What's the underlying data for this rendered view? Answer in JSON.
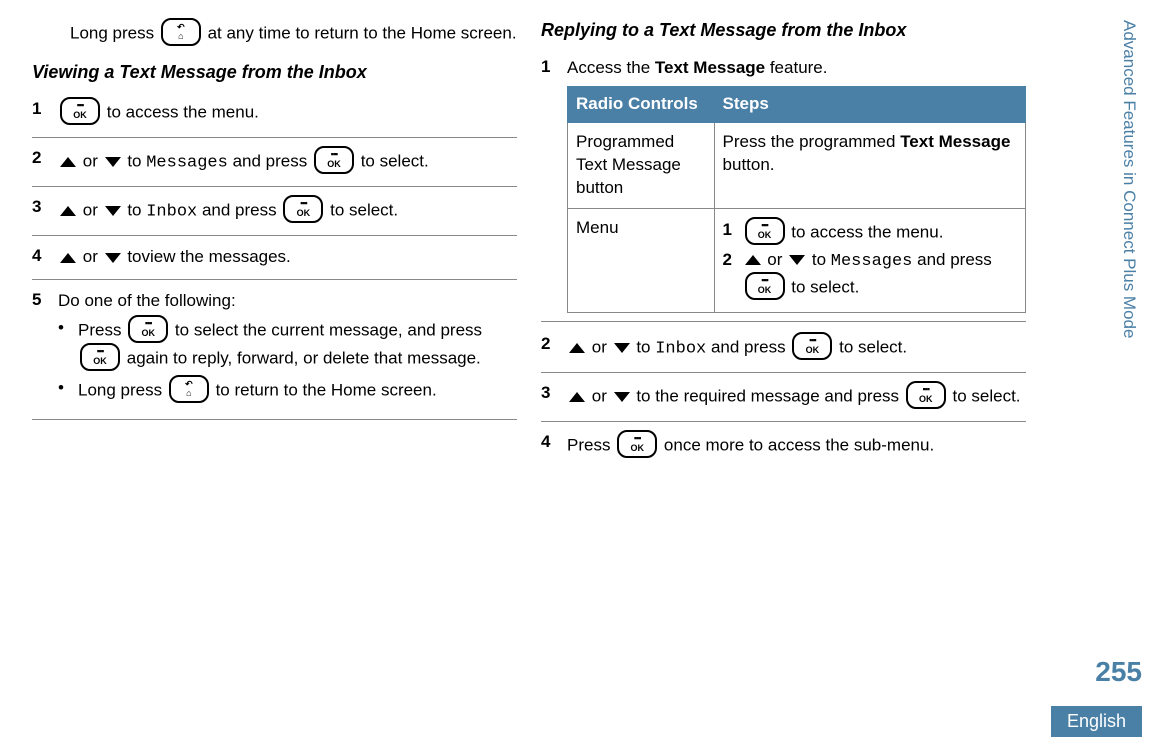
{
  "sidebar": {
    "chapter": "Advanced Features in Connect Plus Mode"
  },
  "pageNumber": "255",
  "language": "English",
  "left": {
    "intro": {
      "pre": "Long press ",
      "post": " at any time to return to the Home screen."
    },
    "heading1": "Viewing a Text Message from the Inbox",
    "steps": {
      "s1": {
        "n": "1",
        "post": " to access the menu."
      },
      "s2": {
        "n": "2",
        "mid_or": " or ",
        "mid_to": " to ",
        "code": "Messages",
        "after_code": " and press ",
        "tail": " to select."
      },
      "s3": {
        "n": "3",
        "mid_or": " or ",
        "mid_to": " to ",
        "code": "Inbox",
        "after_code": " and press ",
        "tail": " to select."
      },
      "s4": {
        "n": "4",
        "mid_or": " or ",
        "tail": " toview the messages."
      },
      "s5": {
        "n": "5",
        "lead": "Do one of the following:",
        "b1": {
          "pre": "Press ",
          "mid": " to select the current message, and press ",
          "post": " again to reply, forward, or delete that message."
        },
        "b2": {
          "pre": "Long press ",
          "post": " to return to the Home screen."
        }
      }
    }
  },
  "right": {
    "heading1": "Replying to a Text Message from the Inbox",
    "s1": {
      "n": "1",
      "pre": "Access the ",
      "bold": "Text Message",
      "post": " feature."
    },
    "table": {
      "h1": "Radio Controls",
      "h2": "Steps",
      "r1c1": "Program­med Text Message button",
      "r1c2": {
        "pre": "Press the programmed ",
        "bold": "Text Mes­sage",
        "post": " button."
      },
      "r2c1": "Menu",
      "r2c2": {
        "m1": {
          "n": "1",
          "post": " to access the menu."
        },
        "m2": {
          "n": "2",
          "mid_or": " or ",
          "mid_to": " to ",
          "code": "Messages",
          "after_code": " and press ",
          "tail": " to select."
        }
      }
    },
    "s2": {
      "n": "2",
      "mid_or": " or ",
      "mid_to": " to ",
      "code": "Inbox",
      "after_code": " and press ",
      "tail": " to select."
    },
    "s3": {
      "n": "3",
      "mid_or": " or ",
      "mid": " to the required message and press ",
      "tail": " to select."
    },
    "s4": {
      "n": "4",
      "pre": "Press ",
      "post": " once more to access the sub-menu."
    }
  },
  "glyphs": {
    "bullet": "•",
    "grid": "▪▪▪",
    "ok": "OK",
    "back": "↶",
    "home": "⌂"
  }
}
